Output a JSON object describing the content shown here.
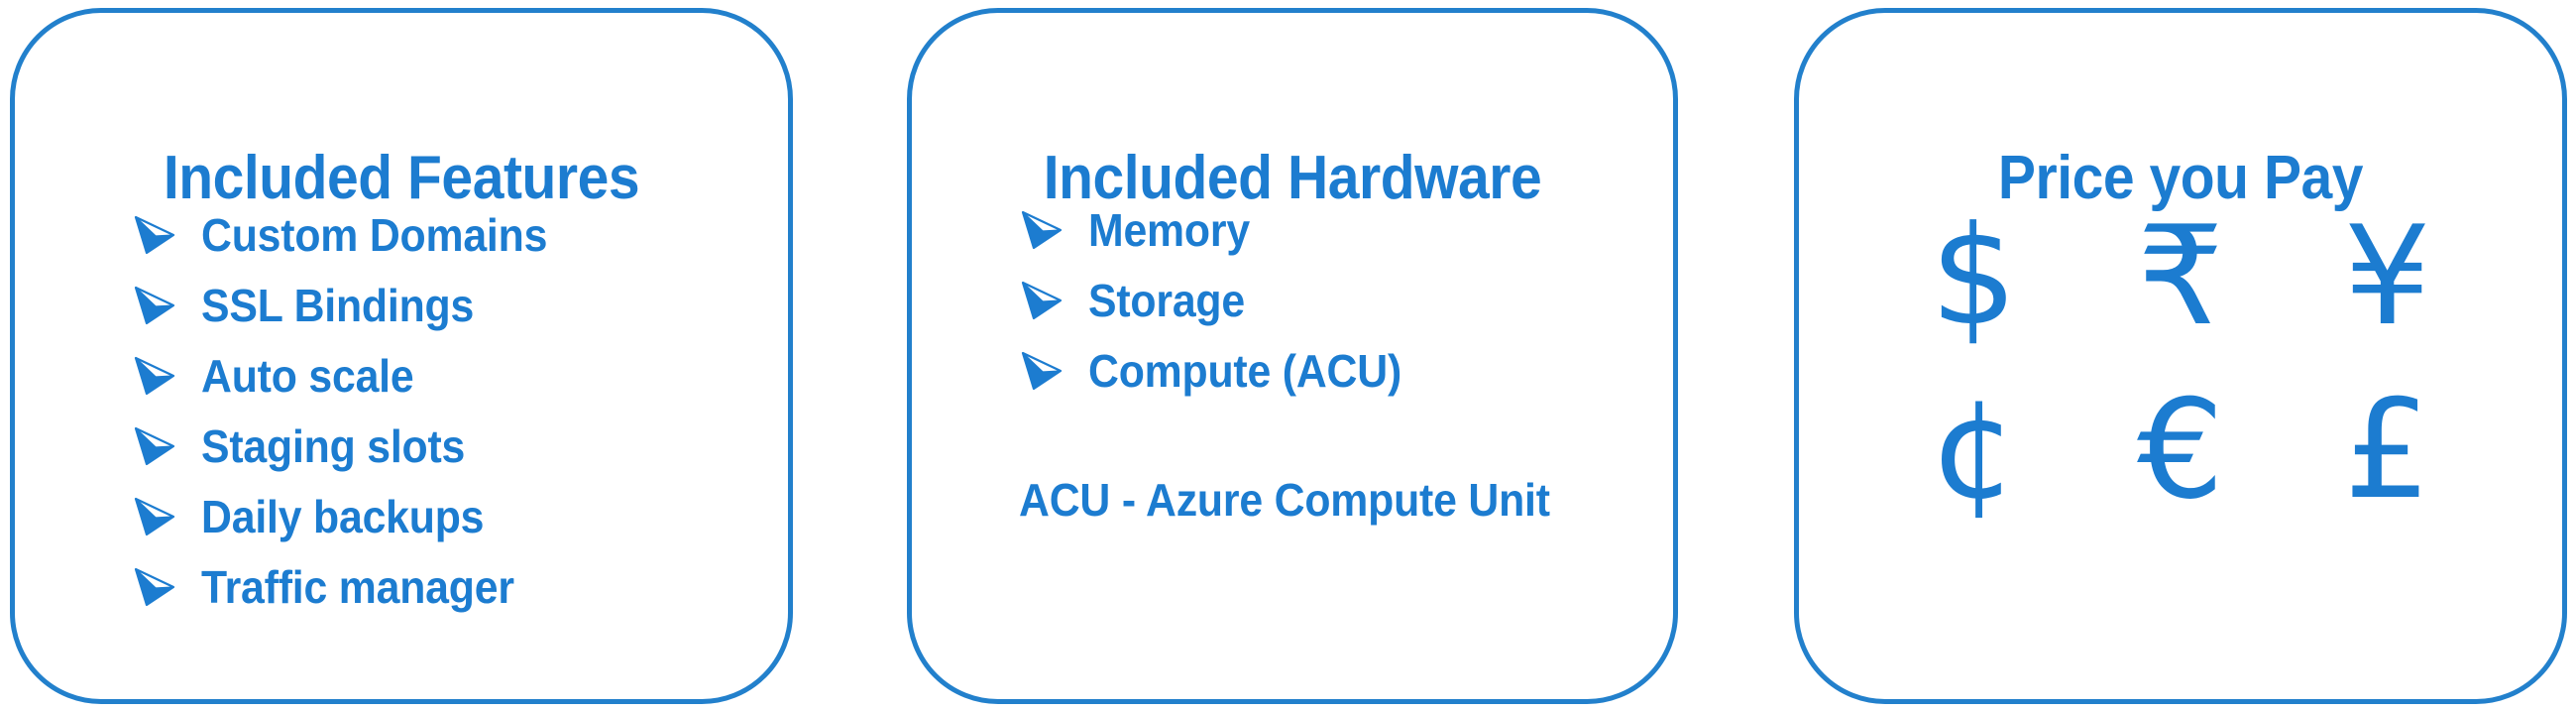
{
  "theme": {
    "accent_blue": "#1C7CD0",
    "border_blue": "#2280CC",
    "background": "#FFFFFF"
  },
  "cards": {
    "features": {
      "title": "Included Features",
      "bullet_icon": "arrowhead-bullet-icon",
      "items": [
        "Custom Domains",
        "SSL Bindings",
        "Auto scale",
        "Staging slots",
        "Daily backups",
        "Traffic manager"
      ]
    },
    "hardware": {
      "title": "Included Hardware",
      "bullet_icon": "arrowhead-bullet-icon",
      "items": [
        "Memory",
        "Storage",
        "Compute (ACU)"
      ],
      "footnote": "ACU - Azure Compute Unit"
    },
    "price": {
      "title": "Price you Pay",
      "currencies": [
        {
          "name": "dollar-sign-icon",
          "glyph": "$"
        },
        {
          "name": "indian-rupee-sign-icon",
          "glyph": "₹"
        },
        {
          "name": "yen-sign-icon",
          "glyph": "¥"
        },
        {
          "name": "cent-sign-icon",
          "glyph": "¢"
        },
        {
          "name": "euro-sign-icon",
          "glyph": "€"
        },
        {
          "name": "pound-sign-icon",
          "glyph": "£"
        }
      ]
    }
  }
}
